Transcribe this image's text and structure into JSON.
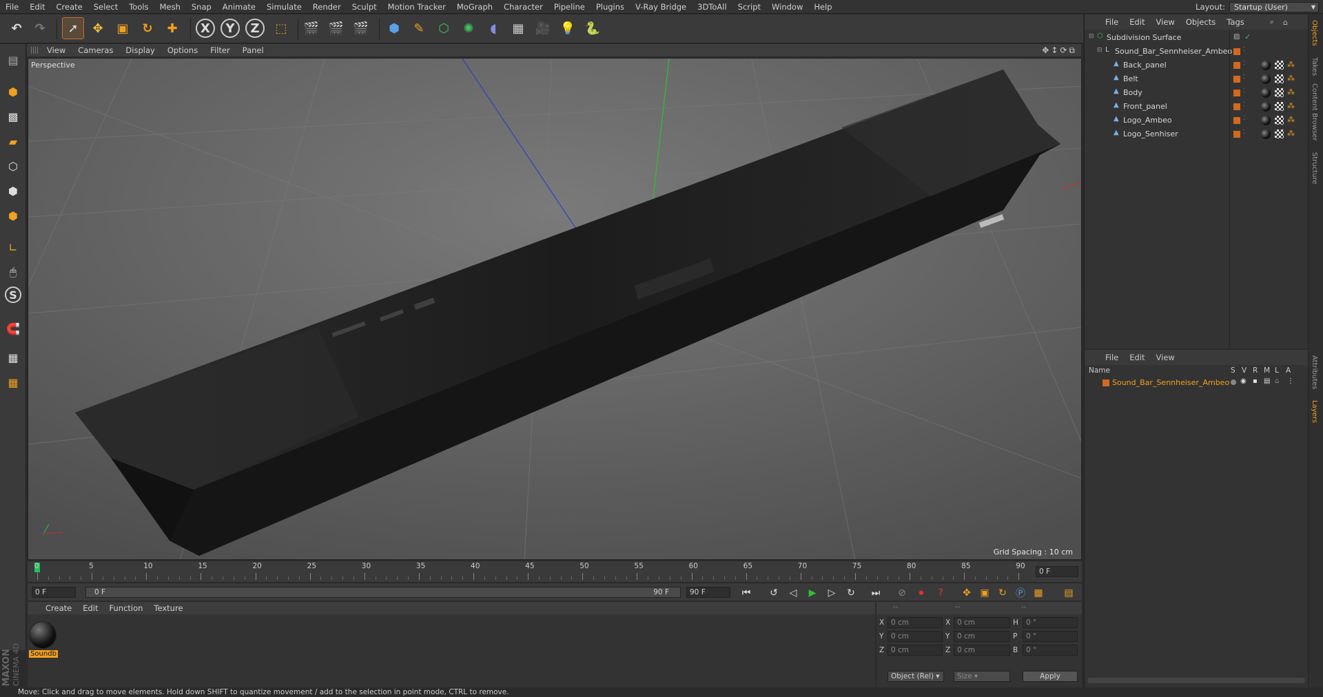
{
  "menubar": {
    "items": [
      "File",
      "Edit",
      "Create",
      "Select",
      "Tools",
      "Mesh",
      "Snap",
      "Animate",
      "Simulate",
      "Render",
      "Sculpt",
      "Motion Tracker",
      "MoGraph",
      "Character",
      "Pipeline",
      "Plugins",
      "V-Ray Bridge",
      "3DToAll",
      "Script",
      "Window",
      "Help"
    ],
    "layout_label": "Layout:",
    "layout_value": "Startup (User)"
  },
  "toolbar": {
    "axis_x": "X",
    "axis_y": "Y",
    "axis_z": "Z",
    "icons": [
      "undo-icon",
      "redo-icon",
      "select-arrow-icon",
      "move-icon",
      "scale-icon",
      "rotate-icon",
      "add-object-icon",
      "x-axis-icon",
      "y-axis-icon",
      "z-axis-icon",
      "world-coords-icon",
      "render-view-icon",
      "render-picture-queue-icon",
      "edit-render-settings-icon",
      "cube-icon",
      "pen-spline-icon",
      "subdivision-icon",
      "array-icon",
      "deformer-icon",
      "floor-icon",
      "camera-icon",
      "light-icon",
      "python-icon"
    ]
  },
  "viewport": {
    "menu": [
      "View",
      "Cameras",
      "Display",
      "Options",
      "Filter",
      "Panel"
    ],
    "camera_label": "Perspective",
    "grid_spacing": "Grid Spacing : 10 cm"
  },
  "timeline": {
    "ticks": [
      "0",
      "5",
      "10",
      "15",
      "20",
      "25",
      "30",
      "35",
      "40",
      "45",
      "50",
      "55",
      "60",
      "65",
      "70",
      "75",
      "80",
      "85",
      "90"
    ],
    "current_frame_right": "0 F"
  },
  "transport": {
    "start_frame": "0 F",
    "range_start": "0 F",
    "range_end": "90 F",
    "end_frame": "90 F"
  },
  "material_manager": {
    "menu": [
      "Create",
      "Edit",
      "Function",
      "Texture"
    ],
    "materials": [
      {
        "name": "Soundb"
      }
    ]
  },
  "coordinates": {
    "header": [
      "--",
      "--",
      "--"
    ],
    "rows": [
      {
        "axis": "X",
        "pos": "0 cm",
        "axis2": "X",
        "size": "0 cm",
        "rot_label": "H",
        "rot": "0 °"
      },
      {
        "axis": "Y",
        "pos": "0 cm",
        "axis2": "Y",
        "size": "0 cm",
        "rot_label": "P",
        "rot": "0 °"
      },
      {
        "axis": "Z",
        "pos": "0 cm",
        "axis2": "Z",
        "size": "0 cm",
        "rot_label": "B",
        "rot": "0 °"
      }
    ],
    "mode_select": "Object (Rel)",
    "size_select": "Size",
    "apply_label": "Apply"
  },
  "object_manager": {
    "menu": [
      "File",
      "Edit",
      "View",
      "Objects",
      "Tags"
    ],
    "objects": [
      {
        "name": "Subdivision Surface",
        "level": 0
      },
      {
        "name": "Sound_Bar_Sennheiser_Ambeo",
        "level": 1
      },
      {
        "name": "Back_panel",
        "level": 2
      },
      {
        "name": "Belt",
        "level": 2
      },
      {
        "name": "Body",
        "level": 2
      },
      {
        "name": "Front_panel",
        "level": 2
      },
      {
        "name": "Logo_Ambeo",
        "level": 2
      },
      {
        "name": "Logo_Senhiser",
        "level": 2
      }
    ]
  },
  "layer_manager": {
    "menu": [
      "File",
      "Edit",
      "View"
    ],
    "columns": {
      "name": "Name",
      "s": "S",
      "v": "V",
      "r": "R",
      "m": "M",
      "l": "L",
      "a": "A"
    },
    "layers": [
      {
        "name": "Sound_Bar_Sennheiser_Ambeo"
      }
    ]
  },
  "right_tabs": [
    "Objects",
    "Takes",
    "Content Browser",
    "Structure",
    "Attributes",
    "Layers"
  ],
  "branding": {
    "maxon": "MAXON",
    "product": "CINEMA 4D"
  },
  "status": "Move: Click and drag to move elements. Hold down SHIFT to quantize movement / add to the selection in point mode, CTRL to remove.",
  "colors": {
    "accent_orange": "#f0a020",
    "layer_orange": "#d2691e",
    "axis_x": "#c03030",
    "axis_y": "#30c030",
    "axis_z": "#3040c0",
    "selection_blue": "#5aa0e6"
  }
}
